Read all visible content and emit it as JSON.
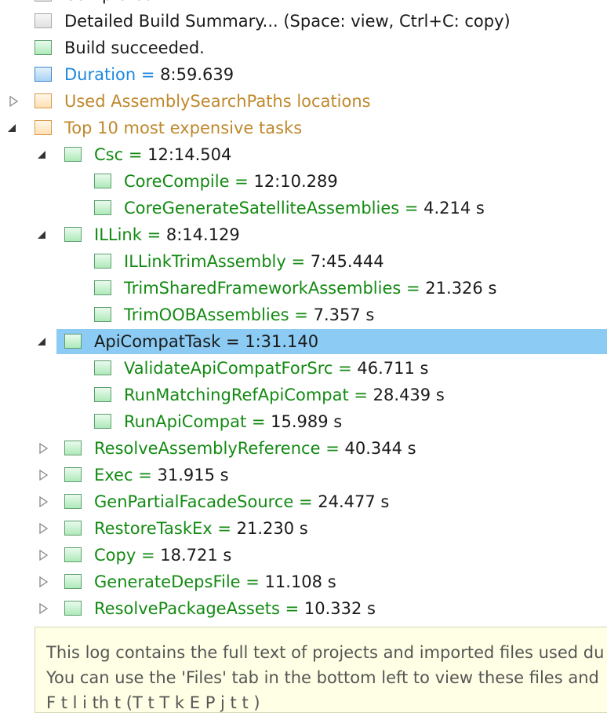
{
  "tree": {
    "partial_top_label": "Completed",
    "rows": [
      {
        "name": "Detailed Build Summary... (Space: view, Ctrl+C: copy)",
        "eq": "",
        "value": ""
      },
      {
        "name": "Build succeeded.",
        "eq": "",
        "value": ""
      },
      {
        "name": "Duration",
        "eq": " = ",
        "value": "8:59.639"
      },
      {
        "name": "Used AssemblySearchPaths locations",
        "eq": "",
        "value": ""
      },
      {
        "name": "Top 10 most expensive tasks",
        "eq": "",
        "value": ""
      },
      {
        "name": "Csc",
        "eq": " = ",
        "value": "12:14.504"
      },
      {
        "name": "CoreCompile",
        "eq": " = ",
        "value": "12:10.289"
      },
      {
        "name": "CoreGenerateSatelliteAssemblies",
        "eq": " = ",
        "value": "4.214 s"
      },
      {
        "name": "ILLink",
        "eq": " = ",
        "value": "8:14.129"
      },
      {
        "name": "ILLinkTrimAssembly",
        "eq": " = ",
        "value": "7:45.444"
      },
      {
        "name": "TrimSharedFrameworkAssemblies",
        "eq": " = ",
        "value": "21.326 s"
      },
      {
        "name": "TrimOOBAssemblies",
        "eq": " = ",
        "value": "7.357 s"
      },
      {
        "name": "ApiCompatTask",
        "eq": " = ",
        "value": "1:31.140"
      },
      {
        "name": "ValidateApiCompatForSrc",
        "eq": " = ",
        "value": "46.711 s"
      },
      {
        "name": "RunMatchingRefApiCompat",
        "eq": " = ",
        "value": "28.439 s"
      },
      {
        "name": "RunApiCompat",
        "eq": " = ",
        "value": "15.989 s"
      },
      {
        "name": "ResolveAssemblyReference",
        "eq": " = ",
        "value": "40.344 s"
      },
      {
        "name": "Exec",
        "eq": " = ",
        "value": "31.915 s"
      },
      {
        "name": "GenPartialFacadeSource",
        "eq": " = ",
        "value": "24.477 s"
      },
      {
        "name": "RestoreTaskEx",
        "eq": " = ",
        "value": "21.230 s"
      },
      {
        "name": "Copy",
        "eq": " = ",
        "value": "18.721 s"
      },
      {
        "name": "GenerateDepsFile",
        "eq": " = ",
        "value": "11.108 s"
      },
      {
        "name": "ResolvePackageAssets",
        "eq": " = ",
        "value": "10.332 s"
      }
    ]
  },
  "note": {
    "line1": "This log contains the full text of projects and imported files used du",
    "line2": "You can use the 'Files' tab in the bottom left to view these files and",
    "line3": "F        t              l    i  th   t      (T        t  T  k  E     P      j  t    t )"
  },
  "colors": {
    "selection": "#8ccbf3",
    "task_name_green": "#138a13",
    "duration_blue": "#1b87e0",
    "folder_gold": "#c0882c",
    "note_background": "#ffffe5"
  }
}
